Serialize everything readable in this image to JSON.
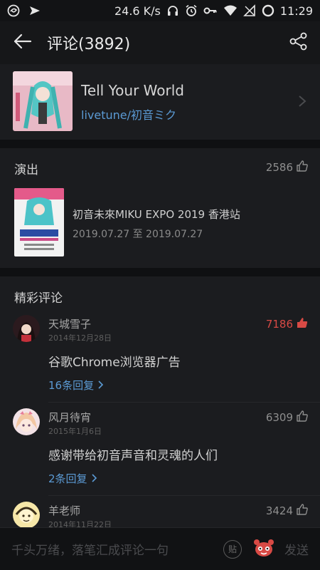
{
  "status": {
    "speed": "24.6 K/s",
    "time": "11:29"
  },
  "header": {
    "title": "评论(3892)"
  },
  "song": {
    "name": "Tell Your World",
    "artist": "livetune/初音ミク"
  },
  "show": {
    "section_title": "演出",
    "likes": "2586",
    "event_title": "初音未來MIKU EXPO 2019 香港站",
    "event_date": "2019.07.27 至 2019.07.27"
  },
  "featured": {
    "section_title": "精彩评论",
    "comments": [
      {
        "user": "天城雪子",
        "date": "2014年12月28日",
        "likes": "7186",
        "text": "谷歌Chrome浏览器广告",
        "replies": "16条回复"
      },
      {
        "user": "风月待宵",
        "date": "2015年1月6日",
        "likes": "6309",
        "text": "感谢带给初音声音和灵魂的人们",
        "replies": "2条回复"
      },
      {
        "user": "羊老师",
        "date": "2014年11月22日",
        "likes": "3424"
      }
    ]
  },
  "composer": {
    "placeholder": "千头万绪，落笔汇成评论一句",
    "sticker_label": "贴",
    "send_label": "发送"
  },
  "colors": {
    "accent_blue": "#5b9ad4",
    "hot_red": "#d84a45",
    "background": "#161719"
  },
  "icons": [
    "wechat-icon",
    "send-arrow-icon",
    "headphones-icon",
    "alarm-icon",
    "key-icon",
    "wifi-icon",
    "signal-icon",
    "battery-icon",
    "back-arrow-icon",
    "share-icon",
    "chevron-right-icon",
    "thumbs-up-icon",
    "emoji-icon"
  ]
}
